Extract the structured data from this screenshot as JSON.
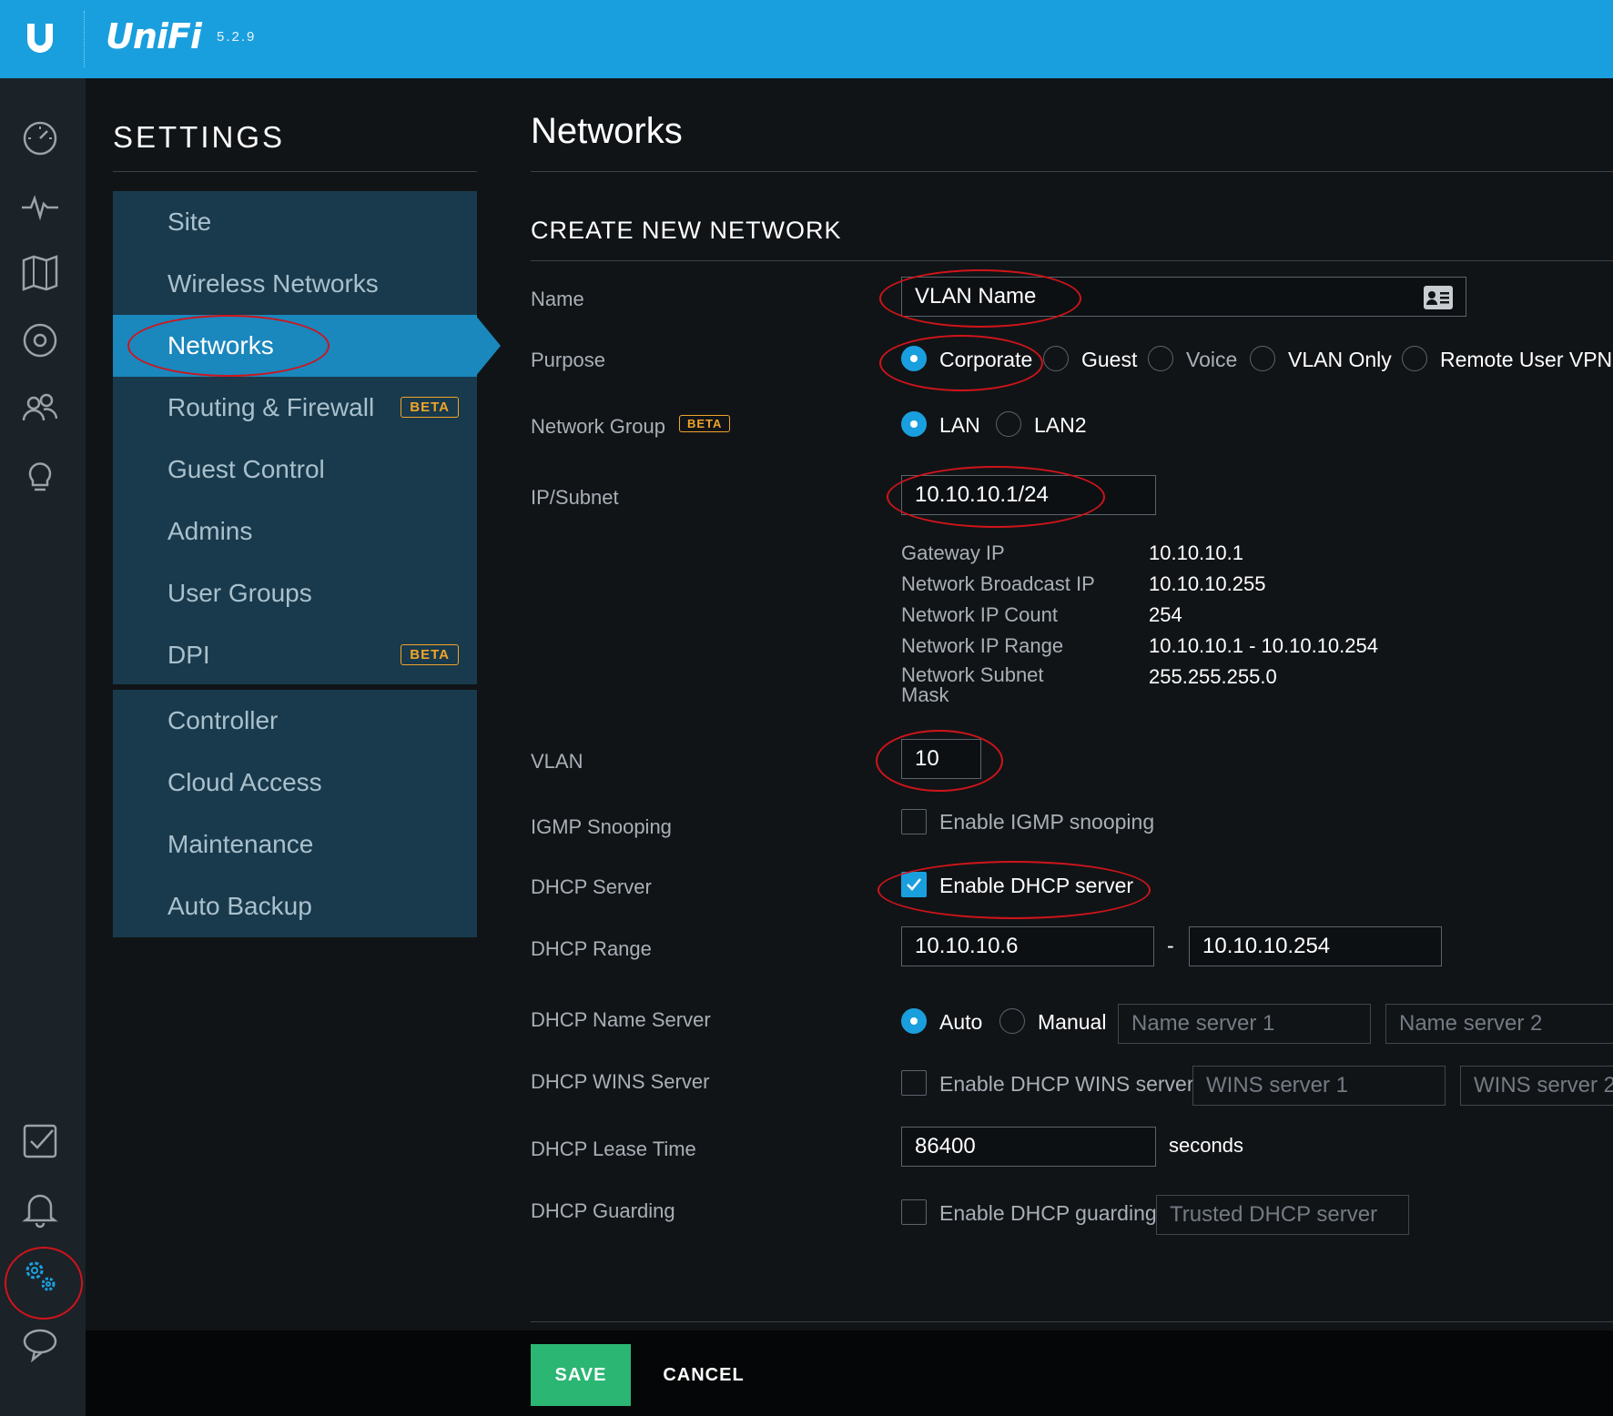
{
  "app": {
    "brand": "UniFi",
    "version": "5.2.9"
  },
  "rail": {
    "icons": [
      "dashboard-icon",
      "statistics-icon",
      "map-icon",
      "devices-icon",
      "clients-icon",
      "insights-icon",
      "events-icon",
      "alerts-icon",
      "settings-icon",
      "chat-icon"
    ]
  },
  "settings": {
    "title": "SETTINGS",
    "items": [
      {
        "label": "Site"
      },
      {
        "label": "Wireless Networks"
      },
      {
        "label": "Networks",
        "active": true
      },
      {
        "label": "Routing & Firewall",
        "badge": "BETA"
      },
      {
        "label": "Guest Control"
      },
      {
        "label": "Admins"
      },
      {
        "label": "User Groups"
      },
      {
        "label": "DPI",
        "badge": "BETA"
      }
    ],
    "items2": [
      {
        "label": "Controller"
      },
      {
        "label": "Cloud Access"
      },
      {
        "label": "Maintenance"
      },
      {
        "label": "Auto Backup"
      }
    ]
  },
  "main": {
    "title": "Networks",
    "section": "CREATE NEW NETWORK",
    "name": {
      "label": "Name",
      "value": "VLAN Name"
    },
    "purpose": {
      "label": "Purpose",
      "options": [
        "Corporate",
        "Guest",
        "Voice",
        "VLAN Only",
        "Remote User VPN"
      ],
      "selected": "Corporate"
    },
    "network_group": {
      "label": "Network Group",
      "badge": "BETA",
      "options": [
        "LAN",
        "LAN2"
      ],
      "selected": "LAN"
    },
    "ip_subnet": {
      "label": "IP/Subnet",
      "value": "10.10.10.1/24"
    },
    "subnet_info": [
      {
        "label": "Gateway IP",
        "value": "10.10.10.1"
      },
      {
        "label": "Network Broadcast IP",
        "value": "10.10.10.255"
      },
      {
        "label": "Network IP Count",
        "value": "254"
      },
      {
        "label": "Network IP Range",
        "value": "10.10.10.1 - 10.10.10.254"
      },
      {
        "label": "Network Subnet Mask",
        "value": "255.255.255.0"
      }
    ],
    "vlan": {
      "label": "VLAN",
      "value": "10"
    },
    "igmp": {
      "label": "IGMP Snooping",
      "checkbox": "Enable IGMP snooping",
      "checked": false
    },
    "dhcp_server": {
      "label": "DHCP Server",
      "checkbox": "Enable DHCP server",
      "checked": true
    },
    "dhcp_range": {
      "label": "DHCP Range",
      "start": "10.10.10.6",
      "separator": "-",
      "end": "10.10.10.254"
    },
    "dhcp_name_server": {
      "label": "DHCP Name Server",
      "options": [
        "Auto",
        "Manual"
      ],
      "selected": "Auto",
      "placeholder1": "Name server 1",
      "placeholder2": "Name server 2"
    },
    "dhcp_wins": {
      "label": "DHCP WINS Server",
      "checkbox": "Enable DHCP WINS server",
      "checked": false,
      "placeholder1": "WINS server 1",
      "placeholder2": "WINS server 2"
    },
    "dhcp_lease": {
      "label": "DHCP Lease Time",
      "value": "86400",
      "unit": "seconds"
    },
    "dhcp_guarding": {
      "label": "DHCP Guarding",
      "checkbox": "Enable DHCP guarding",
      "checked": false,
      "placeholder": "Trusted DHCP server"
    }
  },
  "footer": {
    "save": "SAVE",
    "cancel": "CANCEL"
  },
  "colors": {
    "topbar": "#1a9fde",
    "nav_bg": "#193a4c",
    "nav_active": "#1a87bd",
    "save": "#2bb673",
    "beta": "#f0a52a",
    "annotation": "#d0141a"
  }
}
